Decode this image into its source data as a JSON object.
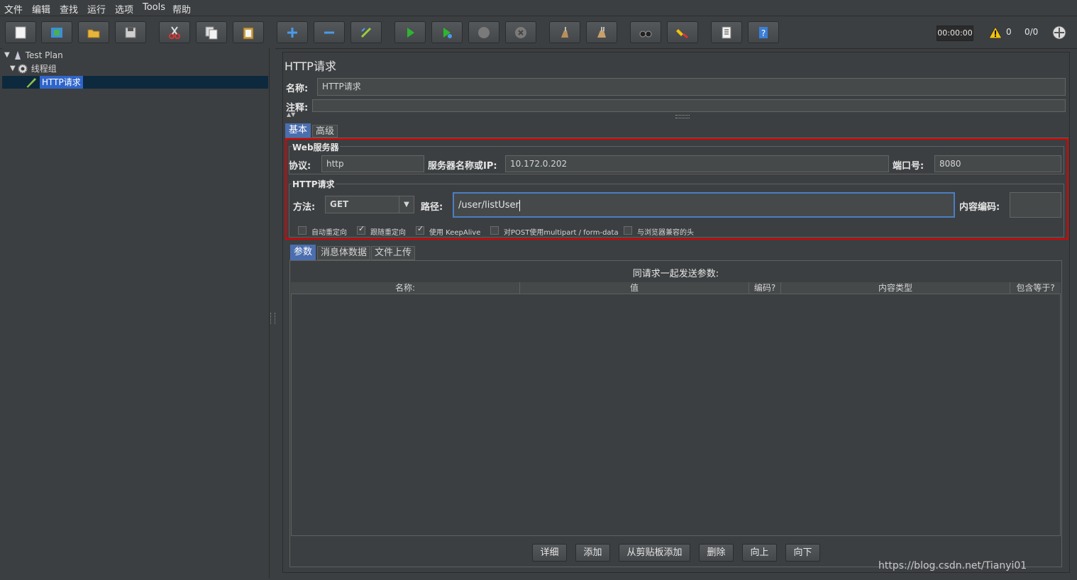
{
  "menu": [
    "文件",
    "编辑",
    "查找",
    "运行",
    "选项",
    "Tools",
    "帮助"
  ],
  "status": {
    "timer": "00:00:00",
    "warnings": "0",
    "threads": "0/0"
  },
  "tree": {
    "root": "Test Plan",
    "thread_group": "线程组",
    "sampler": "HTTP请求"
  },
  "panel": {
    "title": "HTTP请求",
    "name_label": "名称:",
    "name_value": "HTTP请求",
    "comment_label": "注释:",
    "tabs": [
      "基本",
      "高级"
    ],
    "web_server": {
      "legend": "Web服务器",
      "protocol_label": "协议:",
      "protocol_value": "http",
      "server_label": "服务器名称或IP:",
      "server_value": "10.172.0.202",
      "port_label": "端口号:",
      "port_value": "8080"
    },
    "http_request": {
      "legend": "HTTP请求",
      "method_label": "方法:",
      "method_value": "GET",
      "path_label": "路径:",
      "path_value": "/user/listUser",
      "encoding_label": "内容编码:",
      "encoding_value": ""
    },
    "options": [
      {
        "label": "自动重定向",
        "checked": false
      },
      {
        "label": "跟随重定向",
        "checked": true
      },
      {
        "label": "使用 KeepAlive",
        "checked": true
      },
      {
        "label": "对POST使用multipart / form-data",
        "checked": false
      },
      {
        "label": "与浏览器兼容的头",
        "checked": false
      }
    ],
    "subtabs": [
      "参数",
      "消息体数据",
      "文件上传"
    ],
    "params_caption": "同请求一起发送参数:",
    "columns": [
      "名称:",
      "值",
      "编码?",
      "内容类型",
      "包含等于?"
    ],
    "buttons": [
      "详细",
      "添加",
      "从剪贴板添加",
      "删除",
      "向上",
      "向下"
    ]
  },
  "watermark": "https://blog.csdn.net/Tianyi01"
}
